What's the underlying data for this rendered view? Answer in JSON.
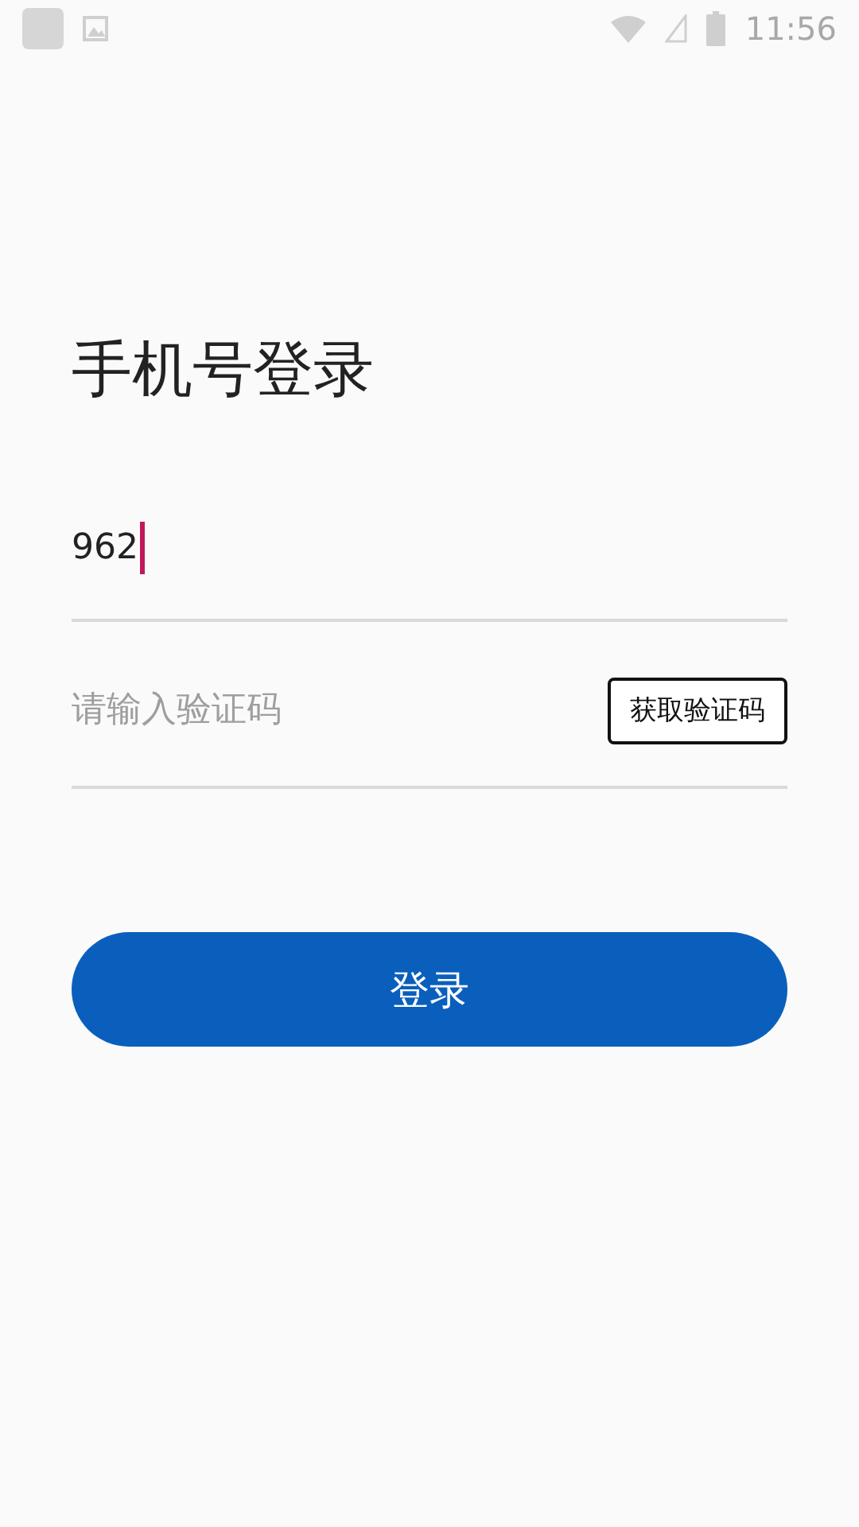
{
  "status_bar": {
    "time": "11:56"
  },
  "title": "手机号登录",
  "phone_field": {
    "value": "962"
  },
  "code_field": {
    "placeholder": "请输入验证码"
  },
  "code_button": {
    "label": "获取验证码"
  },
  "login_button": {
    "label": "登录"
  }
}
